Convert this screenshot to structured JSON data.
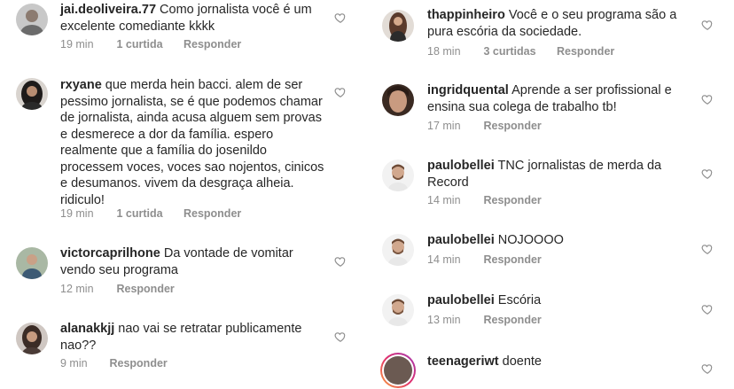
{
  "colors": {
    "text": "#262626",
    "meta": "#8e8e8e"
  },
  "left_comments": [
    {
      "username": "jai.deoliveira.77",
      "text": "Como jornalista você é um excelente comediante kkkk",
      "time": "19 min",
      "likes": "1 curtida",
      "reply": "Responder",
      "avatar_icon": "man-avatar-gray"
    },
    {
      "username": "rxyane",
      "text": "que merda hein bacci. alem de ser pessimo jornalista, se é que podemos chamar de jornalista, ainda acusa alguem sem provas e desmerece a dor da família. espero realmente que a família do josenildo processem voces, voces sao nojentos, cinicos e desumanos. vivem da desgraça alheia. ridiculo!",
      "time": "19 min",
      "likes": "1 curtida",
      "reply": "Responder",
      "avatar_icon": "woman-dark-hair-avatar"
    },
    {
      "username": "victorcaprilhone",
      "text": "Da vontade de vomitar vendo seu programa",
      "time": "12 min",
      "likes": "",
      "reply": "Responder",
      "avatar_icon": "man-outdoor-avatar"
    },
    {
      "username": "alanakkjj",
      "text": "nao vai se retratar publicamente nao??",
      "time": "9 min",
      "likes": "",
      "reply": "Responder",
      "avatar_icon": "woman-avatar"
    }
  ],
  "right_comments": [
    {
      "username": "thappinheiro",
      "text": "Você e o seu programa são a pura escória da sociedade.",
      "time": "18 min",
      "likes": "3 curtidas",
      "reply": "Responder",
      "avatar_icon": "woman-long-hair-avatar"
    },
    {
      "username": "ingridquental",
      "text": "Aprende a ser profissional e ensina sua colega de trabalho tb!",
      "time": "17 min",
      "likes": "",
      "reply": "Responder",
      "avatar_icon": "woman-closeup-avatar"
    },
    {
      "username": "paulobellei",
      "text": "TNC jornalistas de merda da Record",
      "time": "14 min",
      "likes": "",
      "reply": "Responder",
      "avatar_icon": "man-beard-avatar"
    },
    {
      "username": "paulobellei",
      "text": "NOJOOOO",
      "time": "14 min",
      "likes": "",
      "reply": "Responder",
      "avatar_icon": "man-beard-avatar"
    },
    {
      "username": "paulobellei",
      "text": "Escória",
      "time": "13 min",
      "likes": "",
      "reply": "Responder",
      "avatar_icon": "man-beard-avatar"
    },
    {
      "username": "teenageriwt",
      "text": "doente",
      "time": "",
      "likes": "",
      "reply": "",
      "avatar_icon": "story-ring-avatar"
    }
  ]
}
